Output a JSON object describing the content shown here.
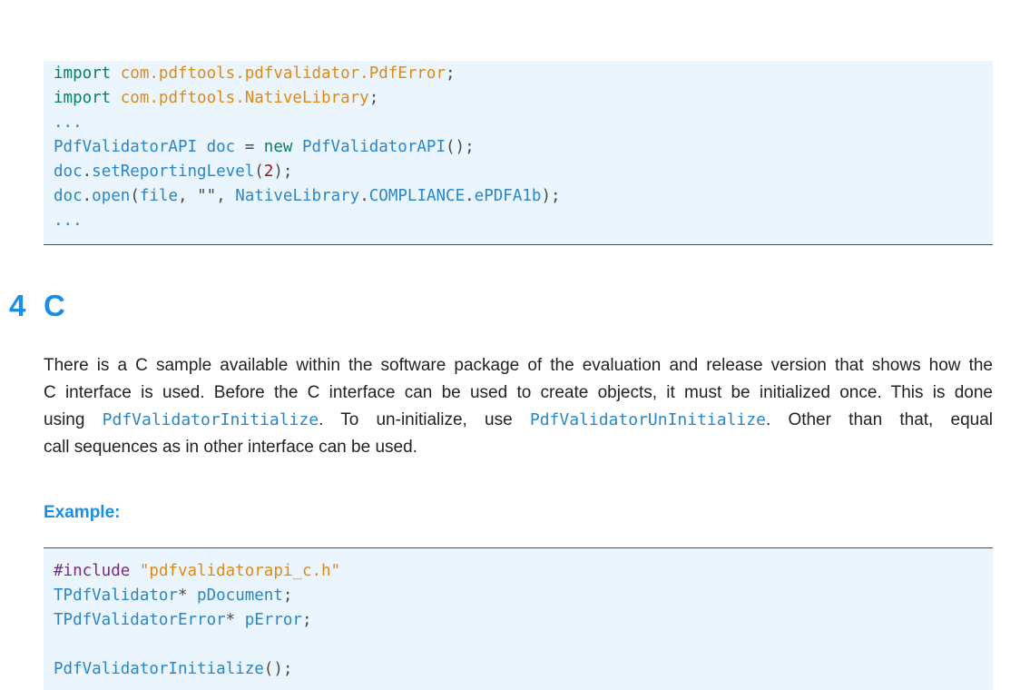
{
  "code_block_1": {
    "lines": [
      [
        {
          "t": "import ",
          "c": "kw"
        },
        {
          "t": "com.pdftools.pdfvalidator.PdfError",
          "c": "str"
        },
        {
          "t": ";",
          "c": ""
        }
      ],
      [
        {
          "t": "import ",
          "c": "kw"
        },
        {
          "t": "com.pdftools.NativeLibrary",
          "c": "str"
        },
        {
          "t": ";",
          "c": ""
        }
      ],
      [
        {
          "t": "...",
          "c": "ty"
        }
      ],
      [
        {
          "t": "PdfValidatorAPI doc ",
          "c": "ty"
        },
        {
          "t": "= ",
          "c": ""
        },
        {
          "t": "new ",
          "c": "kw"
        },
        {
          "t": "PdfValidatorAPI",
          "c": "ty"
        },
        {
          "t": "();",
          "c": ""
        }
      ],
      [
        {
          "t": "doc",
          "c": "ty"
        },
        {
          "t": ".",
          "c": ""
        },
        {
          "t": "setReportingLevel",
          "c": "ty"
        },
        {
          "t": "(",
          "c": ""
        },
        {
          "t": "2",
          "c": "num"
        },
        {
          "t": ");",
          "c": ""
        }
      ],
      [
        {
          "t": "doc",
          "c": "ty"
        },
        {
          "t": ".",
          "c": ""
        },
        {
          "t": "open",
          "c": "ty"
        },
        {
          "t": "(",
          "c": ""
        },
        {
          "t": "file",
          "c": "ty"
        },
        {
          "t": ", ",
          "c": ""
        },
        {
          "t": "\"\"",
          "c": ""
        },
        {
          "t": ", ",
          "c": ""
        },
        {
          "t": "NativeLibrary",
          "c": "ty"
        },
        {
          "t": ".",
          "c": ""
        },
        {
          "t": "COMPLIANCE",
          "c": "ty"
        },
        {
          "t": ".",
          "c": ""
        },
        {
          "t": "ePDFA1b",
          "c": "ty"
        },
        {
          "t": ");",
          "c": ""
        }
      ],
      [
        {
          "t": "...",
          "c": "ty"
        }
      ]
    ]
  },
  "section": {
    "number": "4",
    "title": "C"
  },
  "paragraph": {
    "line1": "There is a C sample available within the software package of the evaluation and release version that shows how the",
    "line2": "C interface is used.  Before the C interface can be used to create objects, it must be initialized once.  This is done",
    "line3_a": "using ",
    "line3_code1": "PdfValidatorInitialize",
    "line3_b": ". To un-initialize, use ",
    "line3_code2": "PdfValidatorUnInitialize",
    "line3_c": ". Other than that, equal",
    "line4": "call sequences as in other interface can be used."
  },
  "example_label": "Example:",
  "code_block_2": {
    "lines": [
      [
        {
          "t": "#include ",
          "c": "pp"
        },
        {
          "t": "\"pdfvalidatorapi_c.h\"",
          "c": "str"
        }
      ],
      [
        {
          "t": "TPdfValidator",
          "c": "ty"
        },
        {
          "t": "* ",
          "c": ""
        },
        {
          "t": "pDocument",
          "c": "ty"
        },
        {
          "t": ";",
          "c": ""
        }
      ],
      [
        {
          "t": "TPdfValidatorError",
          "c": "ty"
        },
        {
          "t": "* ",
          "c": ""
        },
        {
          "t": "pError",
          "c": "ty"
        },
        {
          "t": ";",
          "c": ""
        }
      ],
      [],
      [
        {
          "t": "PdfValidatorInitialize",
          "c": "ty"
        },
        {
          "t": "();",
          "c": ""
        }
      ]
    ]
  },
  "colors": {
    "accent": "#1a8ee2",
    "code_bg": "#eaf5fd",
    "code_rule": "#1a5f7e"
  }
}
